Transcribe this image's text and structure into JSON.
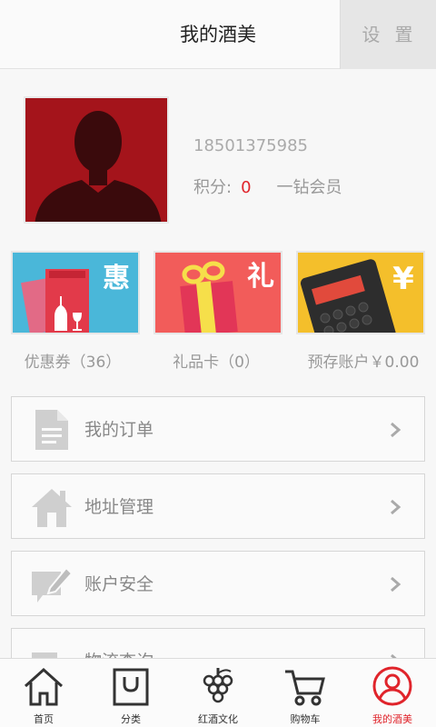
{
  "header": {
    "title": "我的酒美",
    "settings_label": "设置"
  },
  "profile": {
    "phone": "18501375985",
    "points_label": "积分:",
    "points_value": "0",
    "member_level": "一钻会员"
  },
  "cards": [
    {
      "label": "优惠券（36）",
      "badge": "惠",
      "color": "#4ab7d9",
      "icon": "coupon-icon"
    },
    {
      "label": "礼品卡（0）",
      "badge": "礼",
      "color": "#f25c5a",
      "icon": "gift-icon"
    },
    {
      "label": "预存账户￥0.00",
      "badge": "¥",
      "color": "#f4bf2b",
      "icon": "calculator-icon"
    }
  ],
  "menu": [
    {
      "label": "我的订单",
      "icon": "document-icon"
    },
    {
      "label": "地址管理",
      "icon": "house-icon"
    },
    {
      "label": "账户安全",
      "icon": "edit-icon"
    },
    {
      "label": "物流查询",
      "icon": "truck-icon"
    }
  ],
  "tabbar": [
    {
      "label": "首页",
      "icon": "home-icon",
      "active": false
    },
    {
      "label": "分类",
      "icon": "bag-icon",
      "active": false
    },
    {
      "label": "红酒文化",
      "icon": "grape-icon",
      "active": false
    },
    {
      "label": "购物车",
      "icon": "cart-icon",
      "active": false
    },
    {
      "label": "我的酒美",
      "icon": "user-icon",
      "active": true
    }
  ],
  "colors": {
    "accent": "#e0242b",
    "avatar_bg": "#a4141b"
  }
}
